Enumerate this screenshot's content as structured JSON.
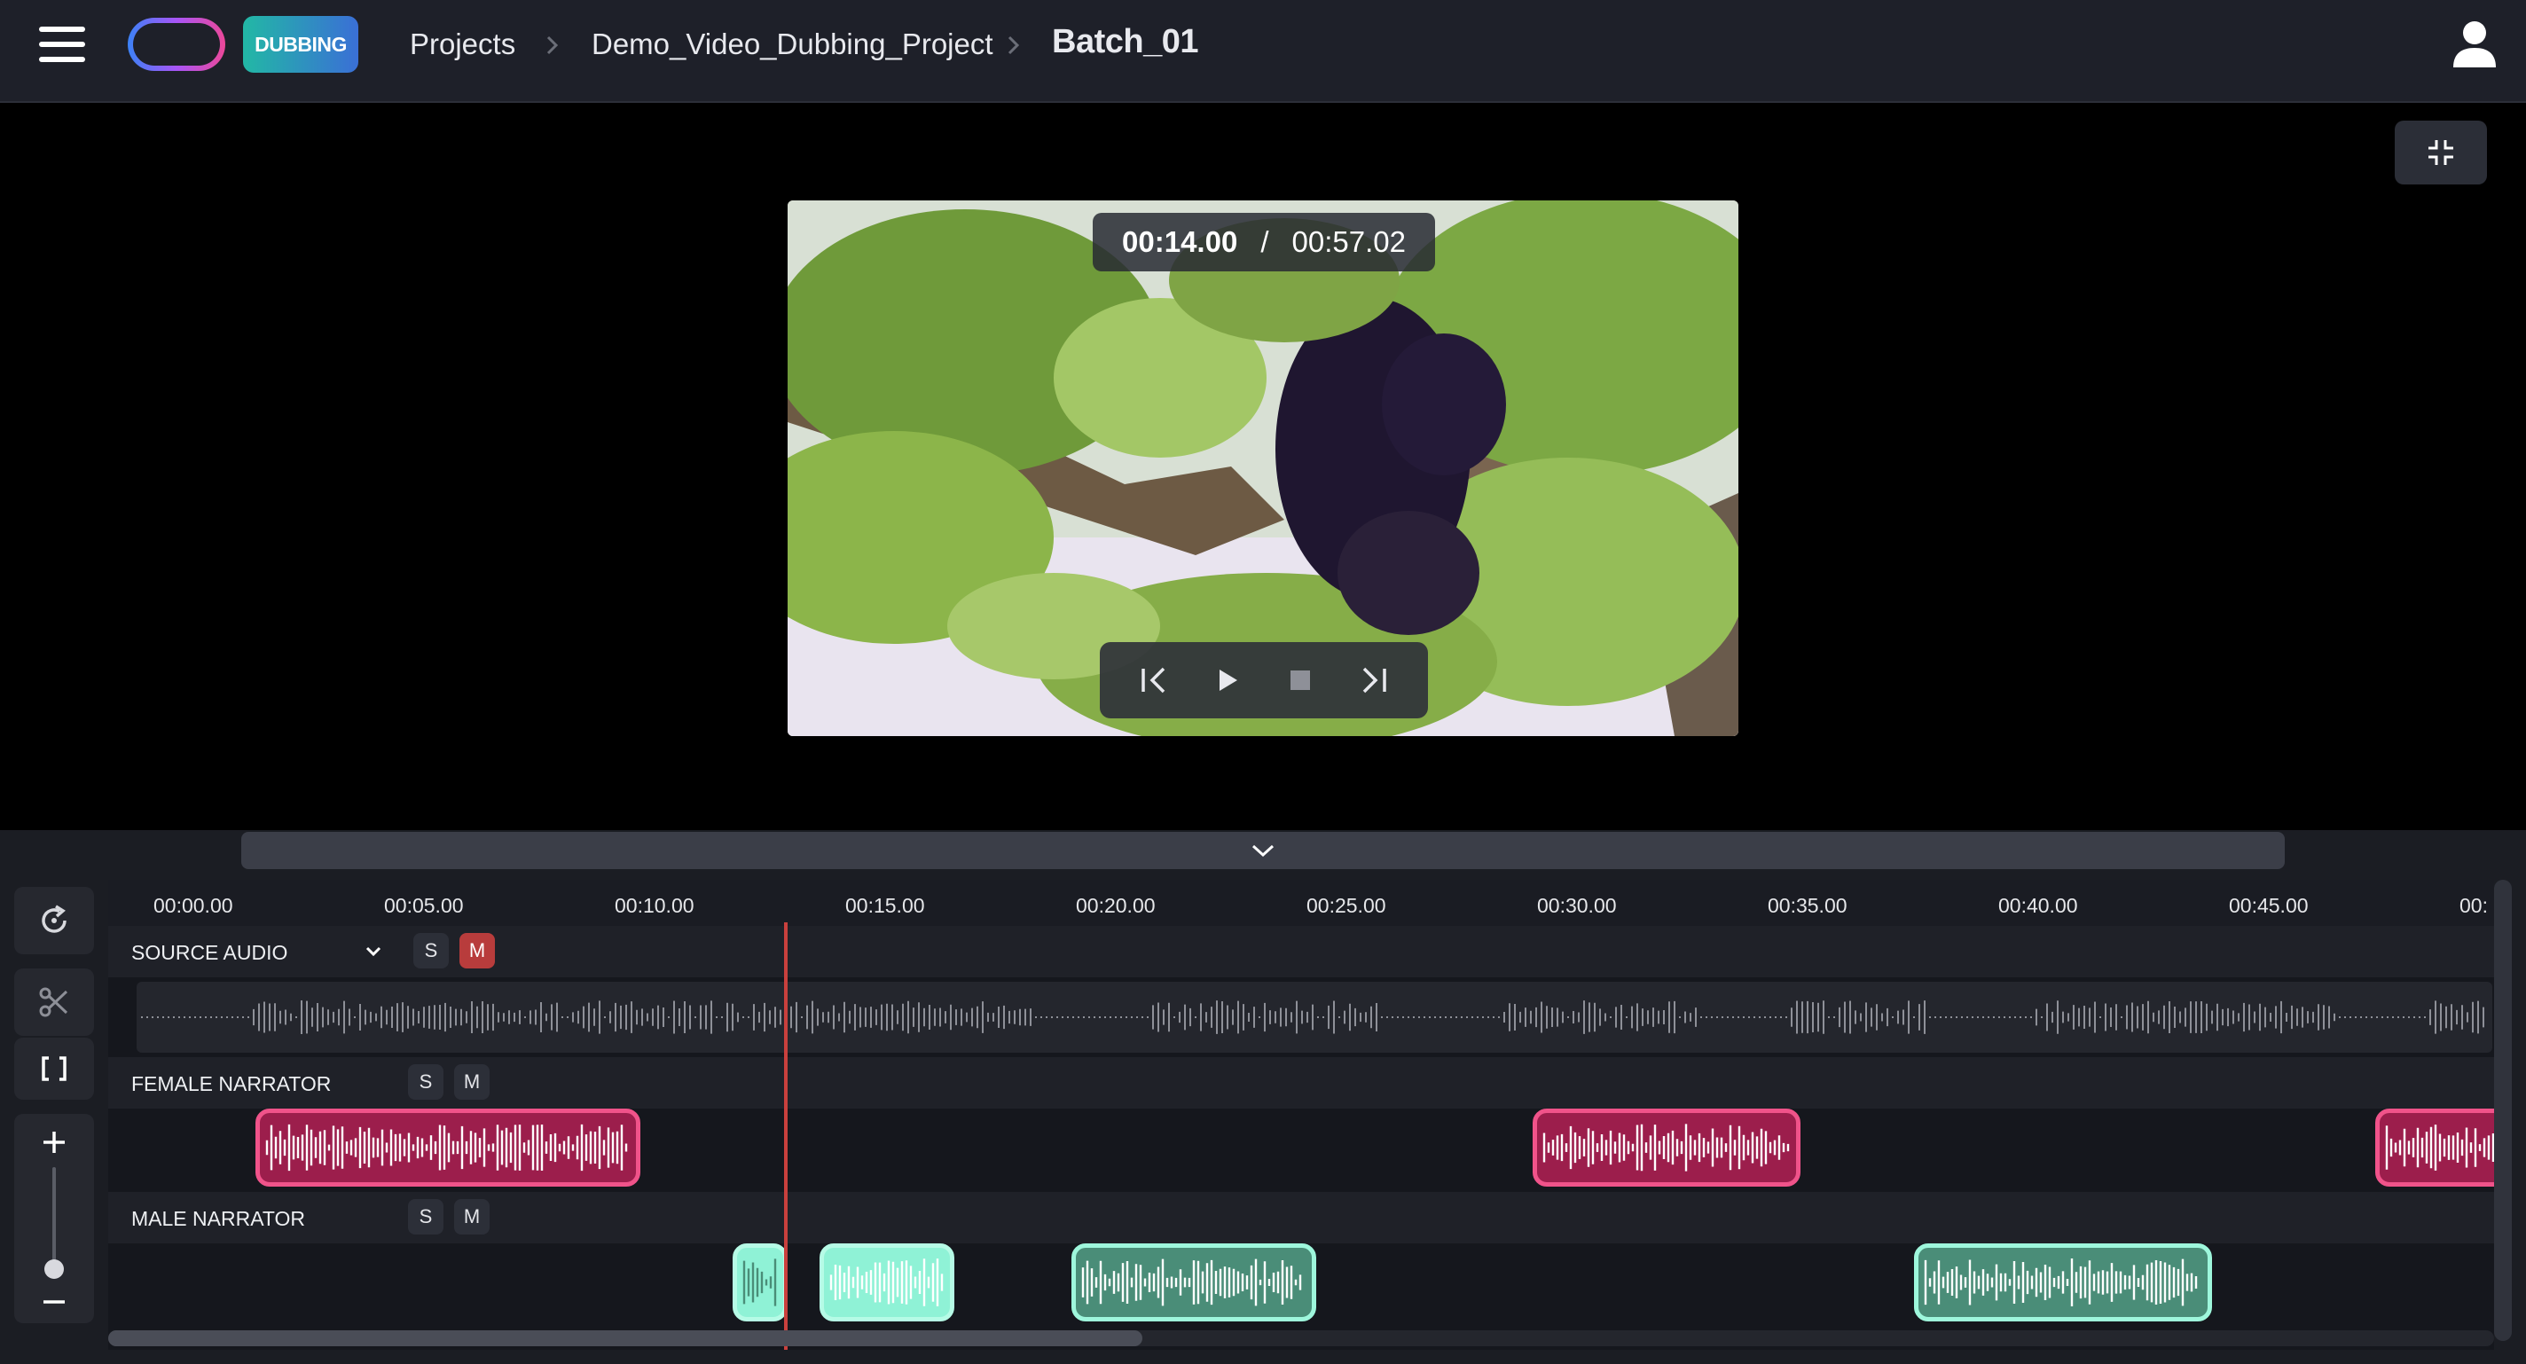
{
  "app": {
    "badge": "DUBBING",
    "breadcrumb": [
      "Projects",
      "Demo_Video_Dubbing_Project",
      "Batch_01"
    ]
  },
  "player": {
    "current_time": "00:14.00",
    "separator": "/",
    "total_time": "00:57.02"
  },
  "timeline": {
    "ruler_ticks": [
      "00:00.00",
      "00:05.00",
      "00:10.00",
      "00:15.00",
      "00:20.00",
      "00:25.00",
      "00:30.00",
      "00:35.00",
      "00:40.00",
      "00:45.00",
      "00:"
    ],
    "tracks": [
      {
        "name": "SOURCE AUDIO",
        "solo_label": "S",
        "mute_label": "M",
        "mute_active": true
      },
      {
        "name": "FEMALE NARRATOR",
        "solo_label": "S",
        "mute_label": "M",
        "mute_active": false
      },
      {
        "name": "MALE NARRATOR",
        "solo_label": "S",
        "mute_label": "M",
        "mute_active": false
      }
    ]
  },
  "colors": {
    "female_clip": "#9c1e4c",
    "female_clip_border": "#f0538a",
    "male_clip": "#4a8d78",
    "male_clip_border": "#9ef7dc",
    "playhead": "#c9403d",
    "mute_active": "#b83c3c"
  },
  "icons": {
    "menu": "hamburger-icon",
    "user": "user-icon",
    "collapse": "collapse-icon",
    "refresh": "refresh-icon",
    "cut": "scissors-icon",
    "brackets": "brackets-icon",
    "zoom_in": "plus-icon",
    "zoom_out": "minus-icon",
    "skip_start": "skip-start-icon",
    "play": "play-icon",
    "stop": "stop-icon",
    "skip_end": "skip-end-icon"
  }
}
